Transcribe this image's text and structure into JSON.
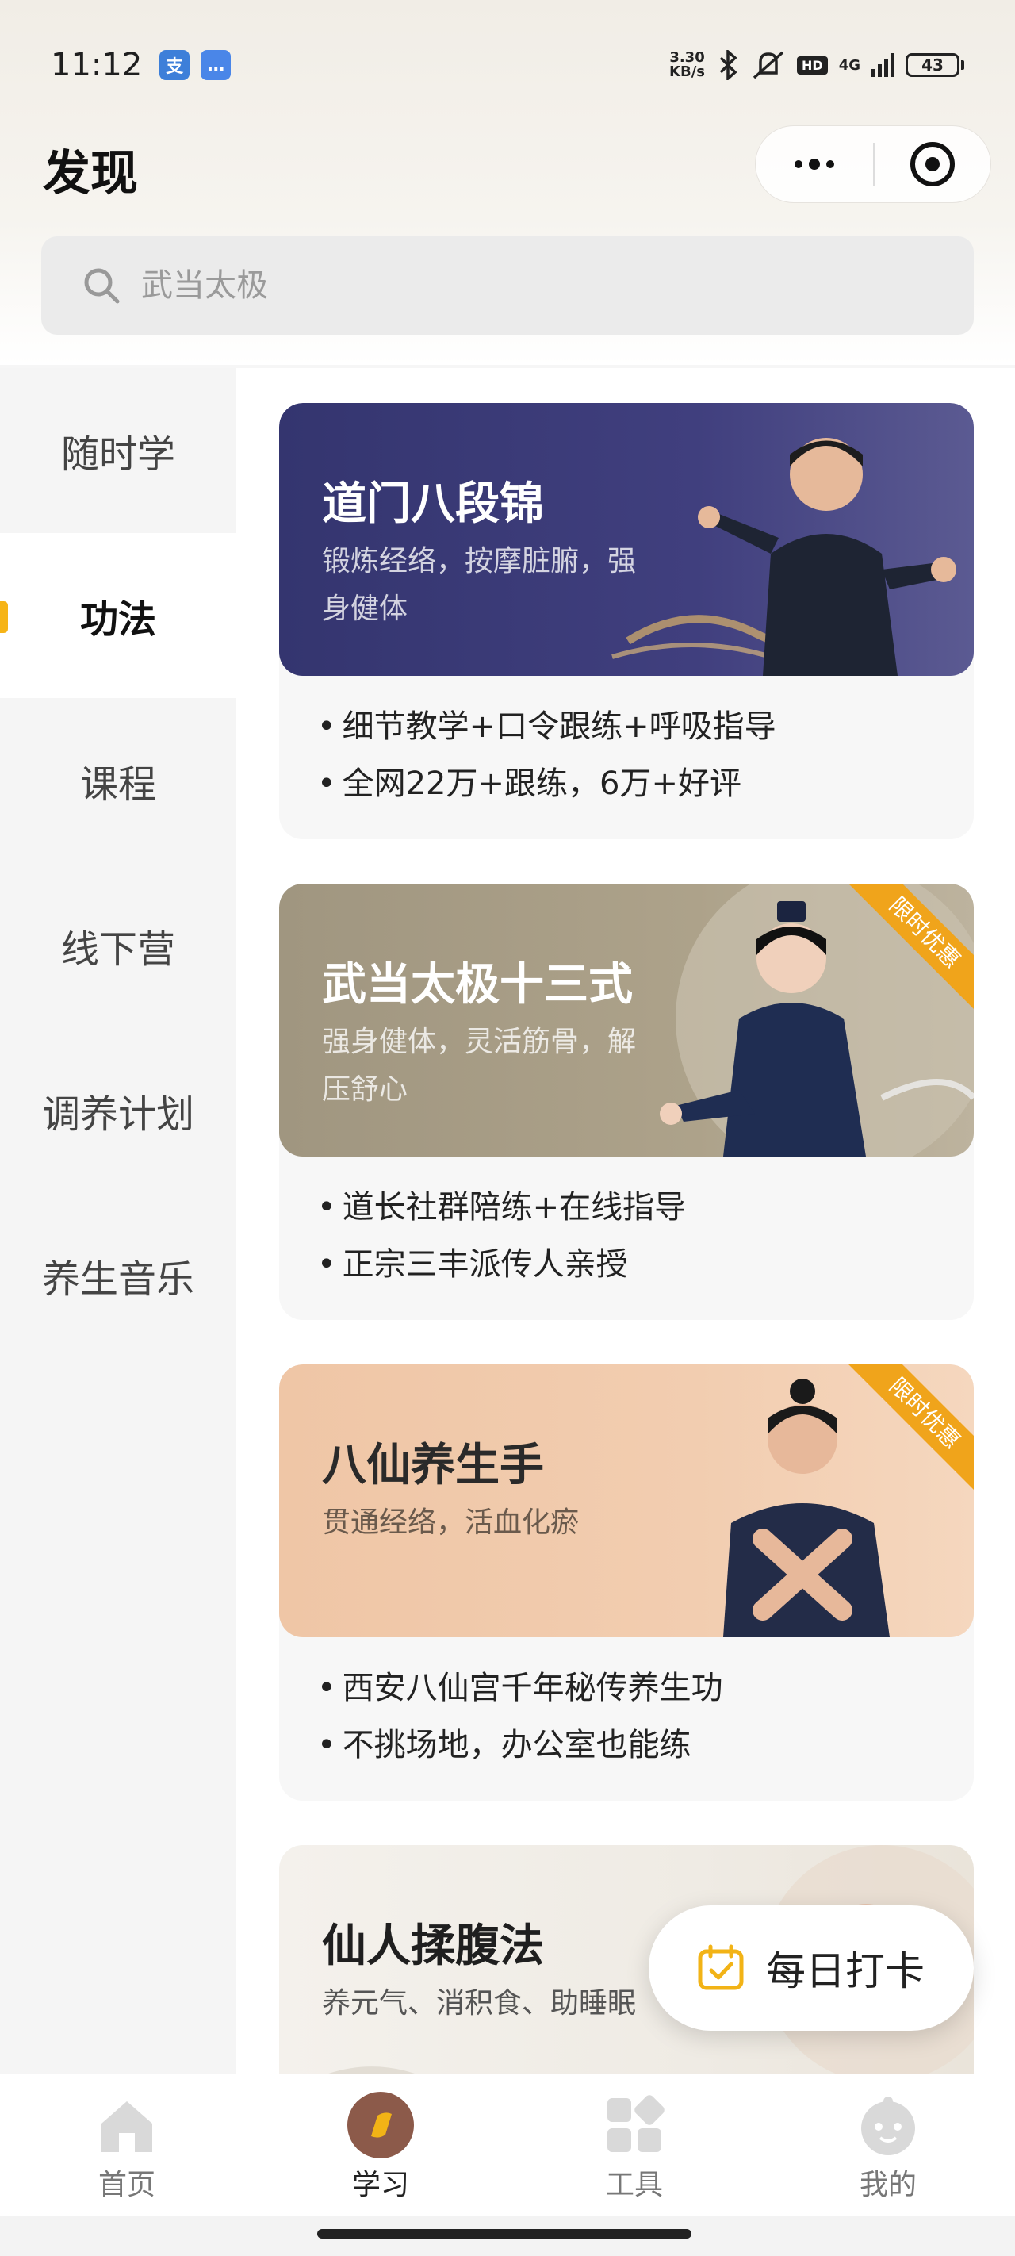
{
  "status_bar": {
    "time": "11:12",
    "app_icons": [
      "支",
      "…"
    ],
    "net_speed_value": "3.30",
    "net_speed_unit": "KB/s",
    "hd_badge": "HD",
    "signal": "4G",
    "battery": "43"
  },
  "header": {
    "title": "发现"
  },
  "search": {
    "placeholder": "武当太极"
  },
  "sidebar": {
    "items": [
      {
        "label": "随时学"
      },
      {
        "label": "功法"
      },
      {
        "label": "课程"
      },
      {
        "label": "线下营"
      },
      {
        "label": "调养计划"
      },
      {
        "label": "养生音乐"
      }
    ],
    "active_index": 1
  },
  "cards": [
    {
      "title": "道门八段锦",
      "subtitle": "锻炼经络，按摩脏腑，强身健体",
      "bullets": [
        "细节教学+口令跟练+呼吸指导",
        "全网22万+跟练，6万+好评"
      ],
      "banner_color": "#3b3b78",
      "ribbon": ""
    },
    {
      "title": "武当太极十三式",
      "subtitle": "强身健体，灵活筋骨，解压舒心",
      "bullets": [
        "道长社群陪练+在线指导",
        "正宗三丰派传人亲授"
      ],
      "banner_color": "#a69a82",
      "ribbon": "限时优惠"
    },
    {
      "title": "八仙养生手",
      "subtitle": "贯通经络，活血化瘀",
      "bullets": [
        "西安八仙宫千年秘传养生功",
        "不挑场地，办公室也能练"
      ],
      "banner_color": "#efc7a6",
      "ribbon": "限时优惠"
    },
    {
      "title": "仙人揉腹法",
      "subtitle": "养元气、消积食、助睡眠",
      "bullets": [],
      "banner_color": "#f2efea",
      "ribbon": ""
    }
  ],
  "floating": {
    "checkin_label": "每日打卡"
  },
  "tabbar": {
    "items": [
      {
        "label": "首页",
        "icon": "home-icon"
      },
      {
        "label": "学习",
        "icon": "study-icon"
      },
      {
        "label": "工具",
        "icon": "tools-icon"
      },
      {
        "label": "我的",
        "icon": "profile-icon"
      }
    ],
    "active_index": 1
  },
  "colors": {
    "accent": "#f6b417",
    "ribbon": "#f0a41b"
  }
}
